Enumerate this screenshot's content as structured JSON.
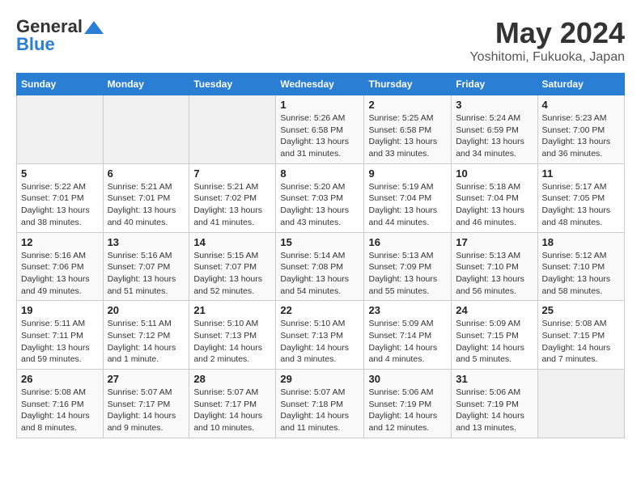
{
  "header": {
    "logo": {
      "general": "General",
      "blue": "Blue",
      "tagline": "GeneralBlue"
    },
    "month": "May 2024",
    "location": "Yoshitomi, Fukuoka, Japan"
  },
  "weekdays": [
    "Sunday",
    "Monday",
    "Tuesday",
    "Wednesday",
    "Thursday",
    "Friday",
    "Saturday"
  ],
  "weeks": [
    [
      {
        "day": "",
        "info": ""
      },
      {
        "day": "",
        "info": ""
      },
      {
        "day": "",
        "info": ""
      },
      {
        "day": "1",
        "sunrise": "Sunrise: 5:26 AM",
        "sunset": "Sunset: 6:58 PM",
        "daylight": "Daylight: 13 hours and 31 minutes."
      },
      {
        "day": "2",
        "sunrise": "Sunrise: 5:25 AM",
        "sunset": "Sunset: 6:58 PM",
        "daylight": "Daylight: 13 hours and 33 minutes."
      },
      {
        "day": "3",
        "sunrise": "Sunrise: 5:24 AM",
        "sunset": "Sunset: 6:59 PM",
        "daylight": "Daylight: 13 hours and 34 minutes."
      },
      {
        "day": "4",
        "sunrise": "Sunrise: 5:23 AM",
        "sunset": "Sunset: 7:00 PM",
        "daylight": "Daylight: 13 hours and 36 minutes."
      }
    ],
    [
      {
        "day": "5",
        "sunrise": "Sunrise: 5:22 AM",
        "sunset": "Sunset: 7:01 PM",
        "daylight": "Daylight: 13 hours and 38 minutes."
      },
      {
        "day": "6",
        "sunrise": "Sunrise: 5:21 AM",
        "sunset": "Sunset: 7:01 PM",
        "daylight": "Daylight: 13 hours and 40 minutes."
      },
      {
        "day": "7",
        "sunrise": "Sunrise: 5:21 AM",
        "sunset": "Sunset: 7:02 PM",
        "daylight": "Daylight: 13 hours and 41 minutes."
      },
      {
        "day": "8",
        "sunrise": "Sunrise: 5:20 AM",
        "sunset": "Sunset: 7:03 PM",
        "daylight": "Daylight: 13 hours and 43 minutes."
      },
      {
        "day": "9",
        "sunrise": "Sunrise: 5:19 AM",
        "sunset": "Sunset: 7:04 PM",
        "daylight": "Daylight: 13 hours and 44 minutes."
      },
      {
        "day": "10",
        "sunrise": "Sunrise: 5:18 AM",
        "sunset": "Sunset: 7:04 PM",
        "daylight": "Daylight: 13 hours and 46 minutes."
      },
      {
        "day": "11",
        "sunrise": "Sunrise: 5:17 AM",
        "sunset": "Sunset: 7:05 PM",
        "daylight": "Daylight: 13 hours and 48 minutes."
      }
    ],
    [
      {
        "day": "12",
        "sunrise": "Sunrise: 5:16 AM",
        "sunset": "Sunset: 7:06 PM",
        "daylight": "Daylight: 13 hours and 49 minutes."
      },
      {
        "day": "13",
        "sunrise": "Sunrise: 5:16 AM",
        "sunset": "Sunset: 7:07 PM",
        "daylight": "Daylight: 13 hours and 51 minutes."
      },
      {
        "day": "14",
        "sunrise": "Sunrise: 5:15 AM",
        "sunset": "Sunset: 7:07 PM",
        "daylight": "Daylight: 13 hours and 52 minutes."
      },
      {
        "day": "15",
        "sunrise": "Sunrise: 5:14 AM",
        "sunset": "Sunset: 7:08 PM",
        "daylight": "Daylight: 13 hours and 54 minutes."
      },
      {
        "day": "16",
        "sunrise": "Sunrise: 5:13 AM",
        "sunset": "Sunset: 7:09 PM",
        "daylight": "Daylight: 13 hours and 55 minutes."
      },
      {
        "day": "17",
        "sunrise": "Sunrise: 5:13 AM",
        "sunset": "Sunset: 7:10 PM",
        "daylight": "Daylight: 13 hours and 56 minutes."
      },
      {
        "day": "18",
        "sunrise": "Sunrise: 5:12 AM",
        "sunset": "Sunset: 7:10 PM",
        "daylight": "Daylight: 13 hours and 58 minutes."
      }
    ],
    [
      {
        "day": "19",
        "sunrise": "Sunrise: 5:11 AM",
        "sunset": "Sunset: 7:11 PM",
        "daylight": "Daylight: 13 hours and 59 minutes."
      },
      {
        "day": "20",
        "sunrise": "Sunrise: 5:11 AM",
        "sunset": "Sunset: 7:12 PM",
        "daylight": "Daylight: 14 hours and 1 minute."
      },
      {
        "day": "21",
        "sunrise": "Sunrise: 5:10 AM",
        "sunset": "Sunset: 7:13 PM",
        "daylight": "Daylight: 14 hours and 2 minutes."
      },
      {
        "day": "22",
        "sunrise": "Sunrise: 5:10 AM",
        "sunset": "Sunset: 7:13 PM",
        "daylight": "Daylight: 14 hours and 3 minutes."
      },
      {
        "day": "23",
        "sunrise": "Sunrise: 5:09 AM",
        "sunset": "Sunset: 7:14 PM",
        "daylight": "Daylight: 14 hours and 4 minutes."
      },
      {
        "day": "24",
        "sunrise": "Sunrise: 5:09 AM",
        "sunset": "Sunset: 7:15 PM",
        "daylight": "Daylight: 14 hours and 5 minutes."
      },
      {
        "day": "25",
        "sunrise": "Sunrise: 5:08 AM",
        "sunset": "Sunset: 7:15 PM",
        "daylight": "Daylight: 14 hours and 7 minutes."
      }
    ],
    [
      {
        "day": "26",
        "sunrise": "Sunrise: 5:08 AM",
        "sunset": "Sunset: 7:16 PM",
        "daylight": "Daylight: 14 hours and 8 minutes."
      },
      {
        "day": "27",
        "sunrise": "Sunrise: 5:07 AM",
        "sunset": "Sunset: 7:17 PM",
        "daylight": "Daylight: 14 hours and 9 minutes."
      },
      {
        "day": "28",
        "sunrise": "Sunrise: 5:07 AM",
        "sunset": "Sunset: 7:17 PM",
        "daylight": "Daylight: 14 hours and 10 minutes."
      },
      {
        "day": "29",
        "sunrise": "Sunrise: 5:07 AM",
        "sunset": "Sunset: 7:18 PM",
        "daylight": "Daylight: 14 hours and 11 minutes."
      },
      {
        "day": "30",
        "sunrise": "Sunrise: 5:06 AM",
        "sunset": "Sunset: 7:19 PM",
        "daylight": "Daylight: 14 hours and 12 minutes."
      },
      {
        "day": "31",
        "sunrise": "Sunrise: 5:06 AM",
        "sunset": "Sunset: 7:19 PM",
        "daylight": "Daylight: 14 hours and 13 minutes."
      },
      {
        "day": "",
        "info": ""
      }
    ]
  ]
}
